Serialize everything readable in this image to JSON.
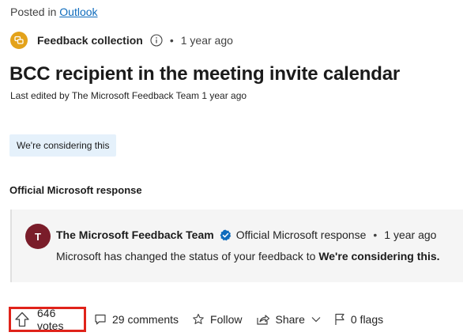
{
  "post": {
    "posted_in_prefix": "Posted in",
    "forum_link": "Outlook",
    "board_name": "Feedback collection",
    "posted_ago": "1 year ago",
    "title": "BCC recipient in the meeting invite calendar",
    "last_edited": "Last edited by The Microsoft Feedback Team 1 year ago",
    "status": "We're considering this"
  },
  "response": {
    "heading": "Official Microsoft response",
    "avatar_letter": "T",
    "author": "The Microsoft Feedback Team",
    "role": "Official Microsoft response",
    "time": "1 year ago",
    "body_prefix": "Microsoft has changed the status of your feedback to ",
    "body_status": "We're considering this."
  },
  "actions": {
    "votes": "646 votes",
    "comments": "29 comments",
    "follow": "Follow",
    "share": "Share",
    "flags": "0 flags"
  },
  "colors": {
    "link": "#0f6cbd",
    "board_icon": "#e3a21a",
    "status_badge_bg": "#e5f1fb",
    "avatar_bg": "#7a1d2a",
    "verified": "#0f6cbd",
    "vote_highlight": "#e0231a"
  },
  "icons": {
    "board": "chat-bubbles-icon",
    "info": "info-icon",
    "verified": "verified-check-icon",
    "vote": "arrow-up-icon",
    "comments": "comment-icon",
    "follow": "star-icon",
    "share": "share-icon",
    "share_menu": "chevron-down-icon",
    "flags": "flag-icon"
  }
}
